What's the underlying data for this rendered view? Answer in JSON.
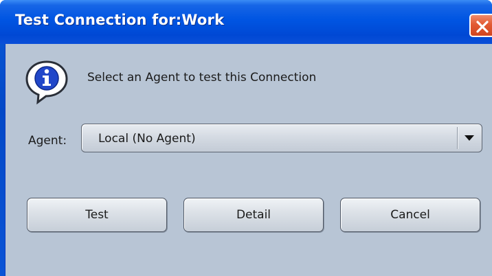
{
  "window": {
    "title": "Test Connection for:Work"
  },
  "message": {
    "text": "Select an Agent to test this Connection"
  },
  "agent": {
    "label": "Agent:",
    "selected": "Local (No Agent)"
  },
  "buttons": {
    "test": "Test",
    "detail": "Detail",
    "cancel": "Cancel"
  },
  "icons": {
    "info": "info-icon",
    "close": "close-icon",
    "dropdown": "triangle-down-icon"
  },
  "colors": {
    "titlebar": "#0055e2",
    "client": "#b8c5d5",
    "close": "#e25a33"
  }
}
